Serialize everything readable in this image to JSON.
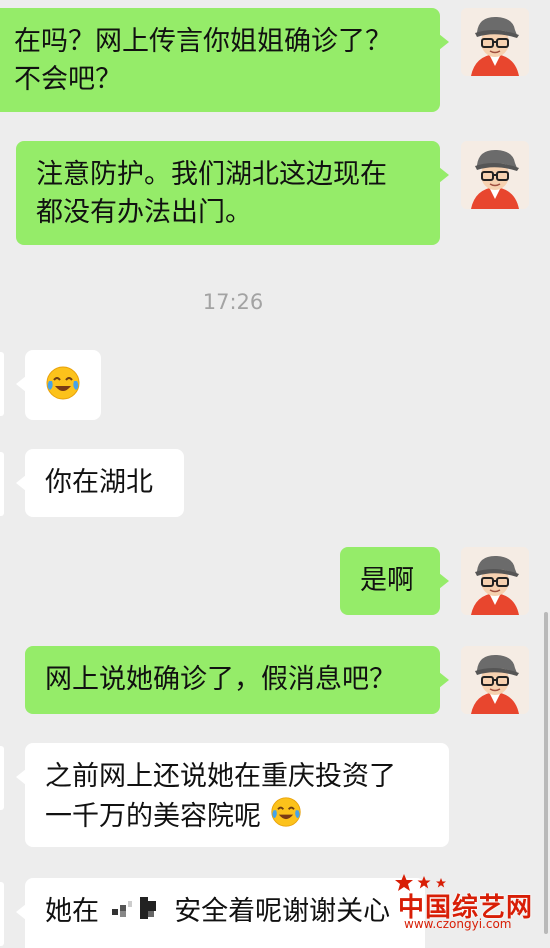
{
  "messages": [
    {
      "side": "out",
      "text_lines": [
        "在吗？网上传言你姐姐确诊了？",
        "不会吧？"
      ]
    },
    {
      "side": "out",
      "text_lines": [
        "注意防护。我们湖北这边现在",
        "都没有办法出门。"
      ]
    },
    {
      "side": "in",
      "emoji": "crying-laughing-face"
    },
    {
      "side": "in",
      "text_lines": [
        "你在湖北"
      ]
    },
    {
      "side": "out",
      "text_lines": [
        "是啊"
      ]
    },
    {
      "side": "out",
      "text_lines": [
        "网上说她确诊了，假消息吧？"
      ]
    },
    {
      "side": "in",
      "text_lines": [
        "之前网上还说她在重庆投资了",
        "一千万的美容院呢"
      ],
      "emoji": "crying-laughing-face"
    },
    {
      "side": "in",
      "text_before": "她在",
      "text_after": "安全着呢谢谢关心",
      "redacted": true
    }
  ],
  "timestamp": "17:26",
  "watermark": {
    "title": "中国综艺网",
    "url": "www.czongyi.com"
  },
  "colors": {
    "background": "#ededed",
    "outgoing_bubble": "#95ec69",
    "incoming_bubble": "#ffffff",
    "watermark": "#d81e06"
  }
}
